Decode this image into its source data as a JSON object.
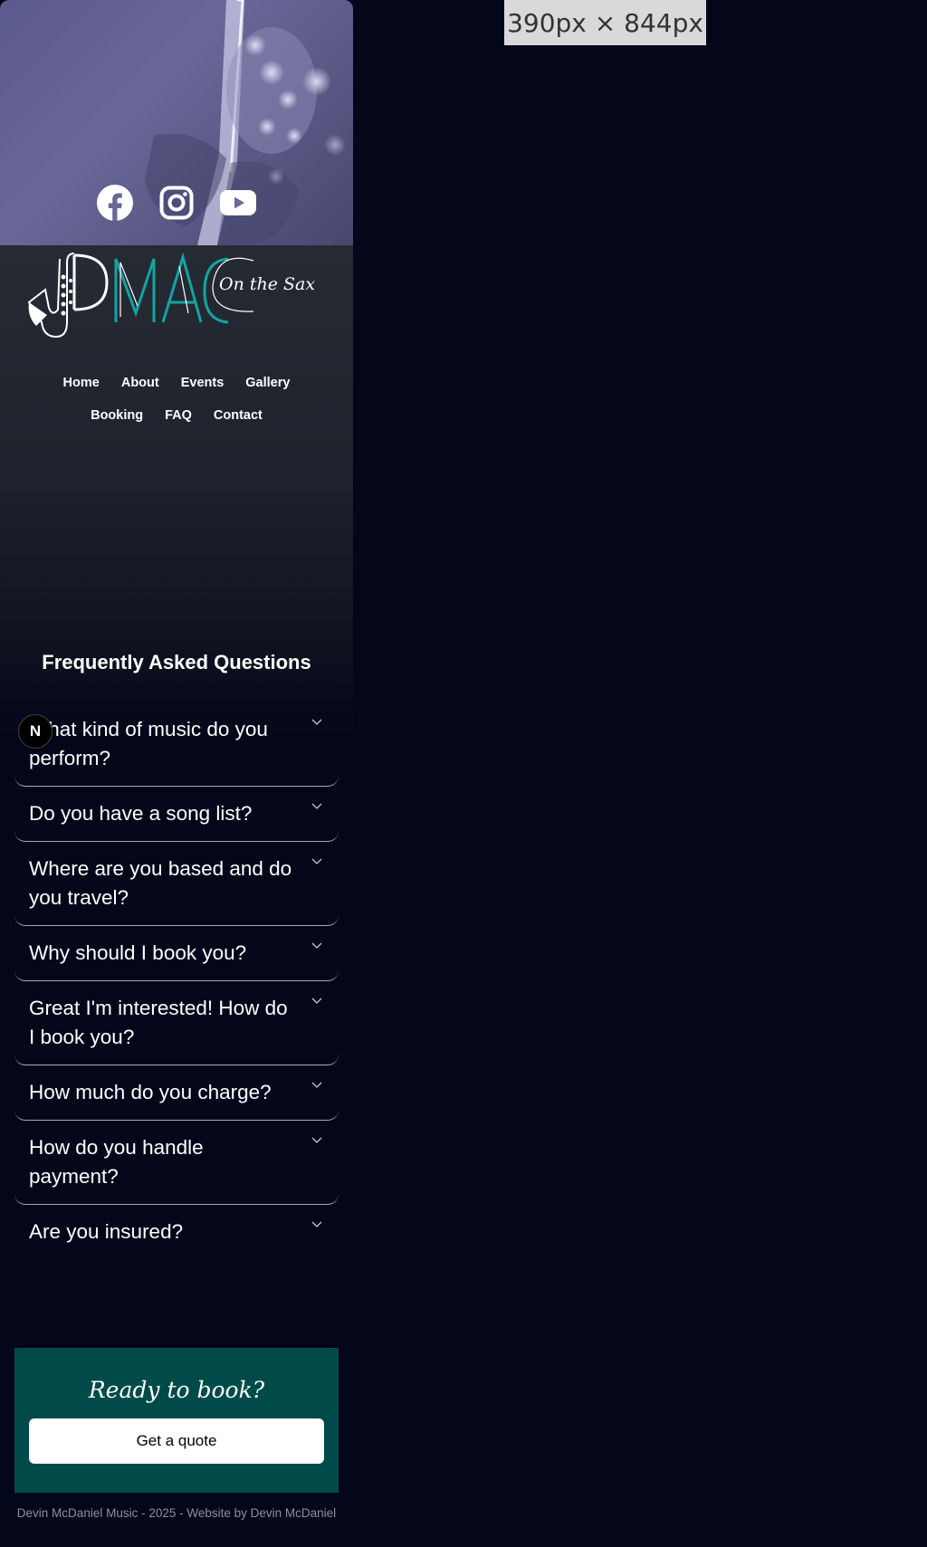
{
  "viewport_label": "390px × 844px",
  "hero": {
    "socials": [
      {
        "icon": "facebook-icon",
        "name": "Facebook"
      },
      {
        "icon": "instagram-icon",
        "name": "Instagram"
      },
      {
        "icon": "youtube-icon",
        "name": "YouTube"
      }
    ]
  },
  "logo": {
    "letters": "DMAC",
    "tagline": "On the Sax",
    "accent_color": "#13a3a3"
  },
  "nav": {
    "row1": [
      "Home",
      "About",
      "Events",
      "Gallery"
    ],
    "row2": [
      "Booking",
      "FAQ",
      "Contact"
    ]
  },
  "faq": {
    "title": "Frequently Asked Questions",
    "items": [
      "What kind of music do you perform?",
      "Do you have a song list?",
      "Where are you based and do you travel?",
      "Why should I book you?",
      "Great I'm interested! How do I book you?",
      "How much do you charge?",
      "How do you handle payment?",
      "Are you insured?"
    ]
  },
  "dev_badge": "N",
  "cta": {
    "title": "Ready to book?",
    "button": "Get a quote",
    "bg_color": "#014a4a"
  },
  "footer": "Devin McDaniel Music - 2025 - Website by Devin McDaniel"
}
